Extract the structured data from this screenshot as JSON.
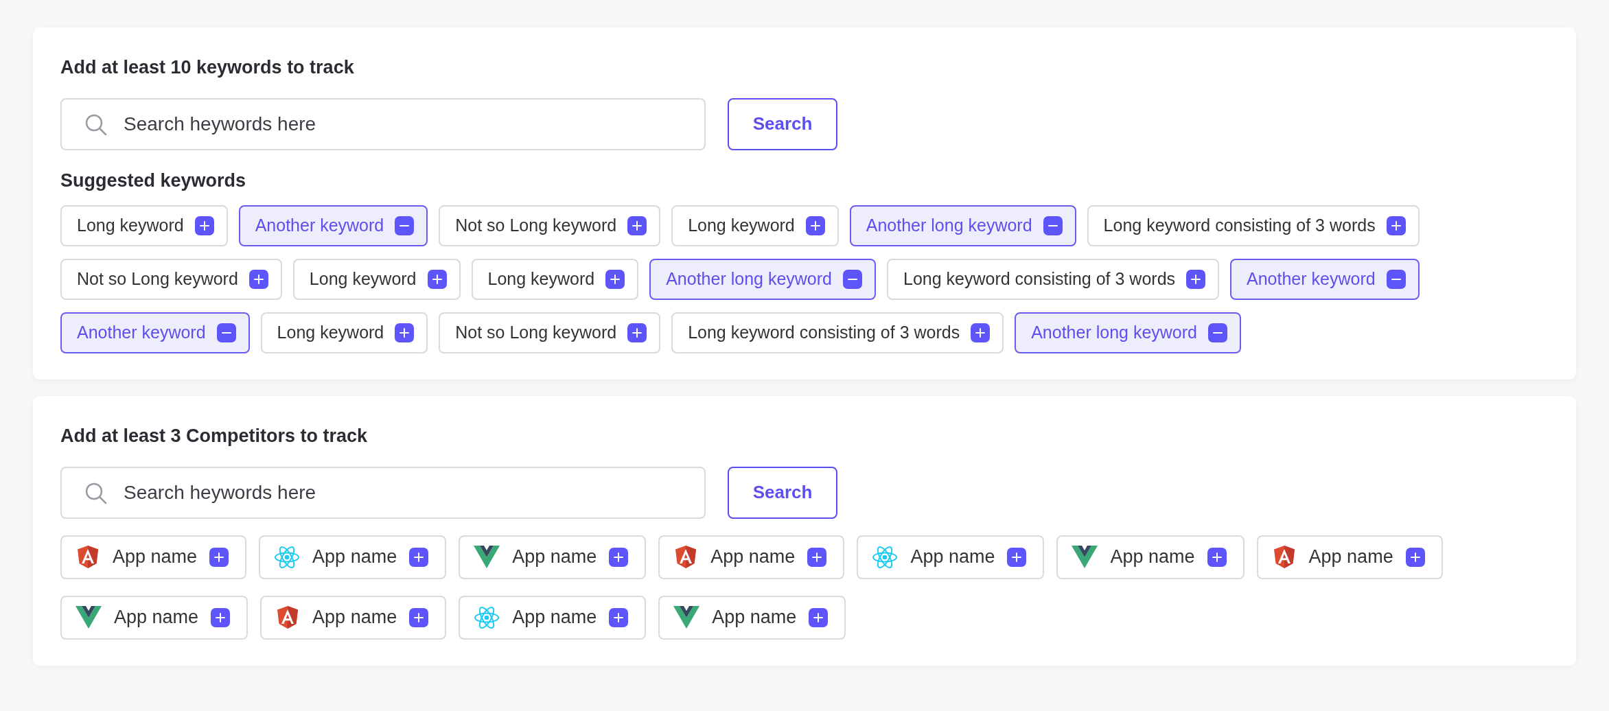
{
  "keywords_card": {
    "title": "Add at least 10 keywords to track",
    "search": {
      "placeholder": "Search heywords here",
      "button": "Search"
    },
    "suggested_title": "Suggested keywords",
    "keyword_rows": [
      [
        {
          "label": "Long keyword",
          "selected": false
        },
        {
          "label": "Another keyword",
          "selected": true
        },
        {
          "label": "Not so Long keyword",
          "selected": false
        },
        {
          "label": "Long keyword",
          "selected": false
        },
        {
          "label": "Another long keyword",
          "selected": true
        },
        {
          "label": "Long keyword consisting of 3 words",
          "selected": false
        }
      ],
      [
        {
          "label": "Not so Long keyword",
          "selected": false
        },
        {
          "label": "Long keyword",
          "selected": false
        },
        {
          "label": "Long keyword",
          "selected": false
        },
        {
          "label": "Another long keyword",
          "selected": true
        },
        {
          "label": "Long keyword consisting of 3 words",
          "selected": false
        },
        {
          "label": "Another keyword",
          "selected": true
        }
      ],
      [
        {
          "label": "Another keyword",
          "selected": true
        },
        {
          "label": "Long keyword",
          "selected": false
        },
        {
          "label": "Not so Long keyword",
          "selected": false
        },
        {
          "label": "Long keyword consisting of 3 words",
          "selected": false
        },
        {
          "label": "Another long keyword",
          "selected": true
        }
      ]
    ]
  },
  "competitors_card": {
    "title": "Add at least 3 Competitors to track",
    "search": {
      "placeholder": "Search heywords here",
      "button": "Search"
    },
    "app_rows": [
      [
        {
          "kind": "angular",
          "label": "App name"
        },
        {
          "kind": "react",
          "label": "App name"
        },
        {
          "kind": "vue",
          "label": "App name"
        },
        {
          "kind": "angular",
          "label": "App name"
        },
        {
          "kind": "react",
          "label": "App name"
        },
        {
          "kind": "vue",
          "label": "App name"
        },
        {
          "kind": "angular",
          "label": "App name"
        }
      ],
      [
        {
          "kind": "vue",
          "label": "App name"
        },
        {
          "kind": "angular",
          "label": "App name"
        },
        {
          "kind": "react",
          "label": "App name"
        },
        {
          "kind": "vue",
          "label": "App name"
        }
      ]
    ]
  }
}
